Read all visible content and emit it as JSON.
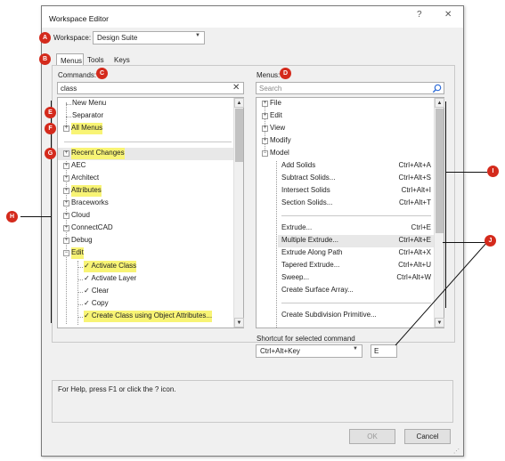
{
  "window": {
    "title": "Workspace Editor",
    "help_glyph": "?",
    "close_glyph": "✕"
  },
  "workspace": {
    "label": "Workspace:",
    "value": "Design Suite"
  },
  "tabs": [
    "Menus",
    "Tools",
    "Keys"
  ],
  "commands": {
    "label": "Commands:",
    "search_value": "class",
    "clear_glyph": "✕",
    "items": [
      {
        "label": "New Menu",
        "expander": false,
        "highlight": false
      },
      {
        "label": "Separator",
        "expander": false,
        "highlight": false
      },
      {
        "label": "All Menus",
        "expander": true,
        "highlight": true
      },
      {
        "label": "Recent Changes",
        "expander": true,
        "highlight": true
      },
      {
        "label": "AEC",
        "expander": true,
        "highlight": false
      },
      {
        "label": "Architect",
        "expander": true,
        "highlight": false
      },
      {
        "label": "Attributes",
        "expander": true,
        "highlight": true
      },
      {
        "label": "Braceworks",
        "expander": true,
        "highlight": false
      },
      {
        "label": "Cloud",
        "expander": true,
        "highlight": false
      },
      {
        "label": "ConnectCAD",
        "expander": true,
        "highlight": false
      },
      {
        "label": "Debug",
        "expander": true,
        "highlight": false
      },
      {
        "label": "Edit",
        "expander": true,
        "expanded": true,
        "highlight": true
      },
      {
        "label": "✓ Activate Class",
        "child": true,
        "highlight": true
      },
      {
        "label": "✓ Activate Layer",
        "child": true,
        "highlight": false
      },
      {
        "label": "✓ Clear",
        "child": true,
        "highlight": false
      },
      {
        "label": "✓ Copy",
        "child": true,
        "highlight": false
      },
      {
        "label": "✓ Create Class using Object Attributes...",
        "child": true,
        "highlight": true
      }
    ]
  },
  "menus": {
    "label": "Menus:",
    "search_placeholder": "Search",
    "items": [
      {
        "label": "File",
        "expander": true
      },
      {
        "label": "Edit",
        "expander": true
      },
      {
        "label": "View",
        "expander": true
      },
      {
        "label": "Modify",
        "expander": true
      },
      {
        "label": "Model",
        "expander": true,
        "expanded": true
      },
      {
        "label": "Add Solids",
        "shortcut": "Ctrl+Alt+A",
        "child": true
      },
      {
        "label": "Subtract Solids...",
        "shortcut": "Ctrl+Alt+S",
        "child": true
      },
      {
        "label": "Intersect Solids",
        "shortcut": "Ctrl+Alt+I",
        "child": true
      },
      {
        "label": "Section Solids...",
        "shortcut": "Ctrl+Alt+T",
        "child": true
      },
      {
        "label": "",
        "separator": true,
        "child": true
      },
      {
        "label": "Extrude...",
        "shortcut": "Ctrl+E",
        "child": true
      },
      {
        "label": "Multiple Extrude...",
        "shortcut": "Ctrl+Alt+E",
        "child": true,
        "selected": true
      },
      {
        "label": "Extrude Along Path",
        "shortcut": "Ctrl+Alt+X",
        "child": true
      },
      {
        "label": "Tapered Extrude...",
        "shortcut": "Ctrl+Alt+U",
        "child": true
      },
      {
        "label": "Sweep...",
        "shortcut": "Ctrl+Alt+W",
        "child": true
      },
      {
        "label": "Create Surface Array...",
        "shortcut": "",
        "child": true
      },
      {
        "label": "",
        "separator": true,
        "child": true
      },
      {
        "label": "Create Subdivision Primitive...",
        "shortcut": "",
        "child": true
      }
    ]
  },
  "shortcut": {
    "label": "Shortcut for selected command",
    "modifier": "Ctrl+Alt+Key",
    "key": "E"
  },
  "help_text": "For Help, press F1 or click the ? icon.",
  "buttons": {
    "ok": "OK",
    "cancel": "Cancel"
  },
  "markers": [
    "A",
    "B",
    "C",
    "D",
    "E",
    "F",
    "G",
    "H",
    "I",
    "J"
  ],
  "colors": {
    "highlight": "#f8f475",
    "marker": "#d42a1c",
    "selected_row": "#e8e8e8"
  }
}
